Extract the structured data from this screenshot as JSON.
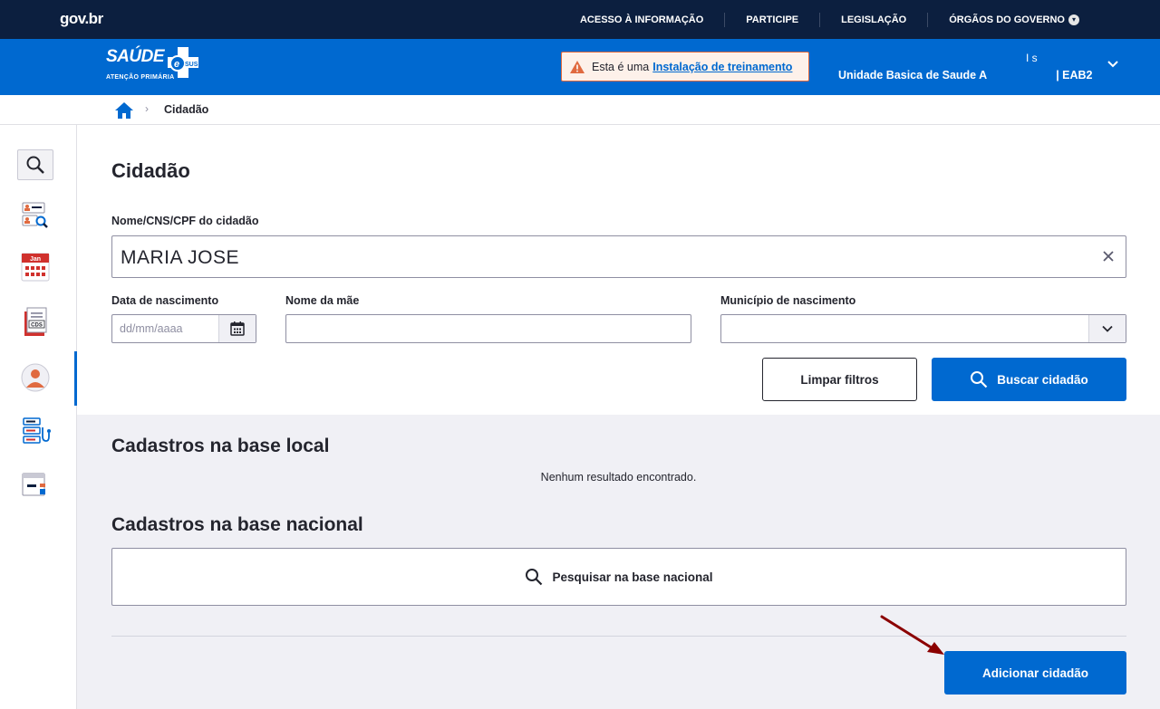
{
  "gov": {
    "logo": "gov.br",
    "links": [
      "ACESSO À INFORMAÇÃO",
      "PARTICIPE",
      "LEGISLAÇÃO",
      "ÓRGÃOS DO GOVERNO"
    ]
  },
  "header": {
    "brand": "SAÚDE",
    "brand_badge": "SUS",
    "brand_sub": "ATENÇÃO PRIMÁRIA",
    "alert_text": "Esta é uma",
    "alert_link": "Instalação de treinamento",
    "user_name": "I s",
    "user_unit": "Unidade Basica de Saude A",
    "user_team": "| EAB2"
  },
  "breadcrumb": {
    "current": "Cidadão"
  },
  "sidebar": {
    "items": [
      "search-icon",
      "citizen-search-icon",
      "calendar-icon",
      "cds-icon",
      "citizen-icon",
      "attendance-icon",
      "admin-icon"
    ],
    "calendar_label": "Jan",
    "cds_label": "CDS"
  },
  "search": {
    "title": "Cidadão",
    "name_label": "Nome/CNS/CPF do cidadão",
    "name_value": "MARIA JOSE",
    "birth_label": "Data de nascimento",
    "birth_placeholder": "dd/mm/aaaa",
    "mother_label": "Nome da mãe",
    "city_label": "Município de nascimento",
    "clear_button": "Limpar filtros",
    "search_button": "Buscar cidadão"
  },
  "results": {
    "local_title": "Cadastros na base local",
    "local_empty": "Nenhum resultado encontrado.",
    "national_title": "Cadastros na base nacional",
    "national_button": "Pesquisar na base nacional",
    "add_button": "Adicionar cidadão"
  },
  "colors": {
    "primary": "#0069d0",
    "govbar": "#0c1f3f",
    "alert_border": "#e06a40",
    "arrow": "#8b0000"
  }
}
